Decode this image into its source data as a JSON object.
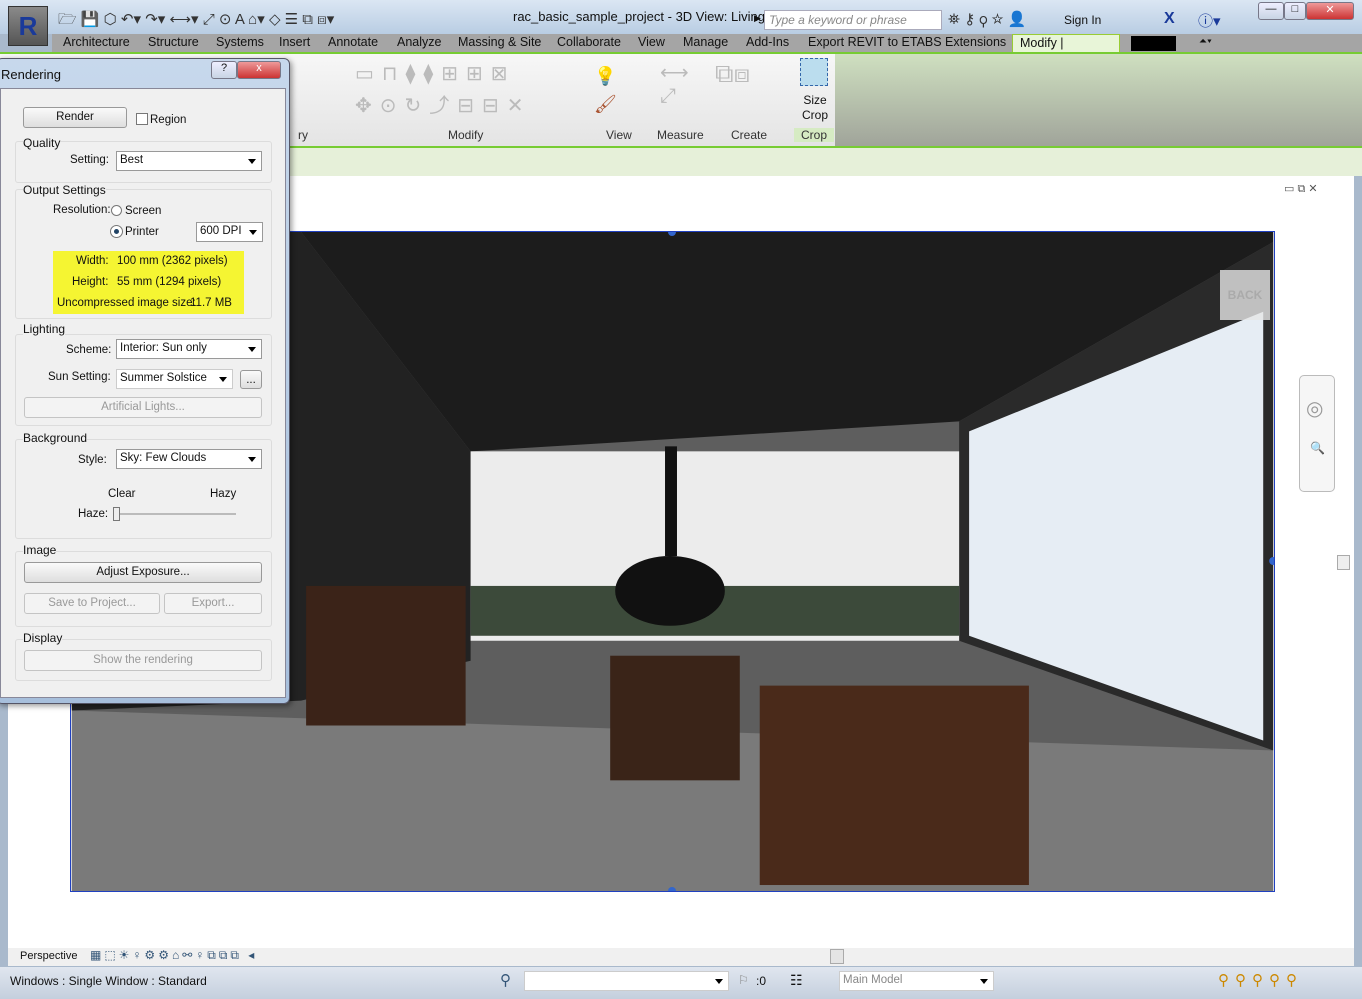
{
  "app": {
    "logo": "R",
    "title": "rac_basic_sample_project - 3D View: Living ...",
    "search_placeholder": "Type a keyword or phrase",
    "sign_in": "Sign In"
  },
  "quick_access": [
    "open-icon",
    "save-icon",
    "sync-icon",
    "undo-icon",
    "redo-icon",
    "measure-icon",
    "dimension-icon",
    "tag-icon",
    "text-icon",
    "3d-view-icon",
    "section-icon",
    "thin-lines-icon",
    "close-hidden-icon",
    "switch-windows-icon"
  ],
  "tabs": [
    "Architecture",
    "Structure",
    "Systems",
    "Insert",
    "Annotate",
    "Analyze",
    "Massing & Site",
    "Collaborate",
    "View",
    "Manage",
    "Add-Ins",
    "Export REVIT to ETABS",
    "Extensions",
    "Modify | Cameras"
  ],
  "ribbon": {
    "panels": [
      "ry",
      "Modify",
      "View",
      "Measure",
      "Create",
      "Crop"
    ],
    "size_crop": "Size Crop"
  },
  "dialog": {
    "title": "Rendering",
    "help": "?",
    "close": "x",
    "render": "Render",
    "region": "Region",
    "quality": {
      "label": "Quality",
      "setting_label": "Setting:",
      "setting": "Best"
    },
    "output": {
      "label": "Output Settings",
      "resolution_label": "Resolution:",
      "screen": "Screen",
      "printer": "Printer",
      "dpi": "600 DPI",
      "width_label": "Width:",
      "width": "100 mm (2362 pixels)",
      "height_label": "Height:",
      "height": "55 mm (1294 pixels)",
      "size_label": "Uncompressed image size:",
      "size": "11.7 MB"
    },
    "lighting": {
      "label": "Lighting",
      "scheme_label": "Scheme:",
      "scheme": "Interior: Sun only",
      "sun_label": "Sun Setting:",
      "sun": "Summer Solstice",
      "more": "...",
      "artificial": "Artificial Lights..."
    },
    "background": {
      "label": "Background",
      "style_label": "Style:",
      "style": "Sky: Few Clouds",
      "clear": "Clear",
      "hazy": "Hazy",
      "haze_label": "Haze:",
      "haze": 0
    },
    "image": {
      "label": "Image",
      "adjust": "Adjust Exposure...",
      "save": "Save to Project...",
      "export": "Export..."
    },
    "display": {
      "label": "Display",
      "show": "Show the rendering"
    }
  },
  "viewcube": {
    "back": "BACK"
  },
  "view_control": {
    "mode": "Perspective"
  },
  "status": {
    "text": "Windows : Single Window : Standard",
    "worksets": ":0",
    "model": "Main Model"
  }
}
